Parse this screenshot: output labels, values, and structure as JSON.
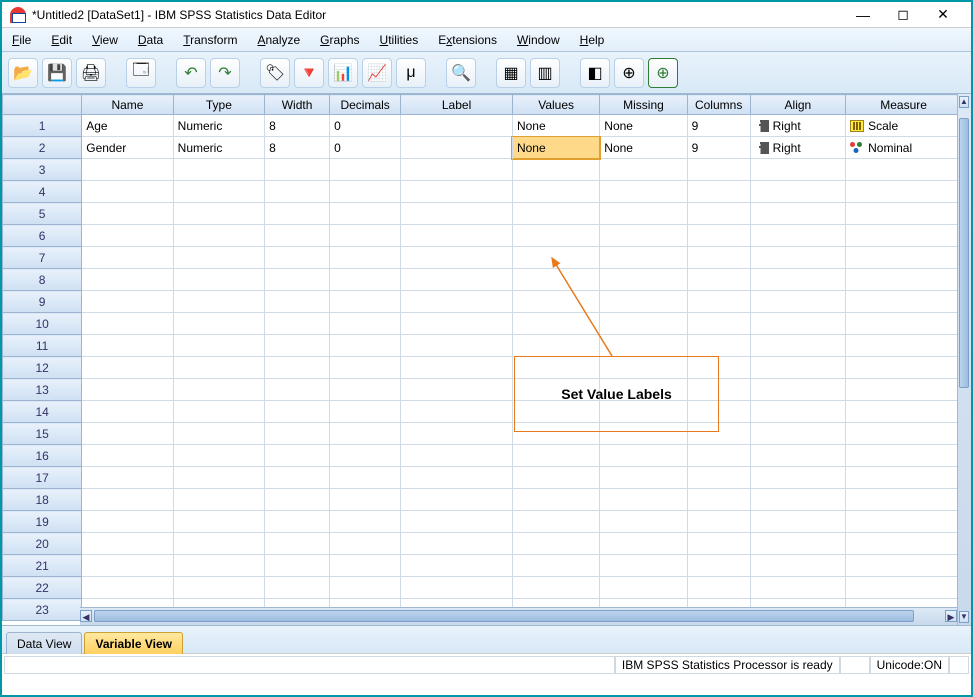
{
  "window": {
    "title": "*Untitled2 [DataSet1] - IBM SPSS Statistics Data Editor"
  },
  "menu": {
    "file": "File",
    "edit": "Edit",
    "view": "View",
    "data": "Data",
    "transform": "Transform",
    "analyze": "Analyze",
    "graphs": "Graphs",
    "utilities": "Utilities",
    "extensions": "Extensions",
    "window": "Window",
    "help": "Help"
  },
  "columns": {
    "name": "Name",
    "type": "Type",
    "width": "Width",
    "decimals": "Decimals",
    "label": "Label",
    "values": "Values",
    "missing": "Missing",
    "cols": "Columns",
    "align": "Align",
    "measure": "Measure"
  },
  "rows": [
    {
      "n": "1",
      "name": "Age",
      "type": "Numeric",
      "width": "8",
      "decimals": "0",
      "label": "",
      "values": "None",
      "missing": "None",
      "cols": "9",
      "align": "Right",
      "measure": "Scale"
    },
    {
      "n": "2",
      "name": "Gender",
      "type": "Numeric",
      "width": "8",
      "decimals": "0",
      "label": "",
      "values": "None",
      "missing": "None",
      "cols": "9",
      "align": "Right",
      "measure": "Nominal"
    }
  ],
  "blank_row_numbers": [
    "3",
    "4",
    "5",
    "6",
    "7",
    "8",
    "9",
    "10",
    "11",
    "12",
    "13",
    "14",
    "15",
    "16",
    "17",
    "18",
    "19",
    "20",
    "21",
    "22",
    "23"
  ],
  "tabs": {
    "data_view": "Data View",
    "variable_view": "Variable View"
  },
  "status": {
    "processor": "IBM SPSS Statistics Processor is ready",
    "unicode": "Unicode:ON"
  },
  "annotation": {
    "text": "Set Value Labels"
  }
}
